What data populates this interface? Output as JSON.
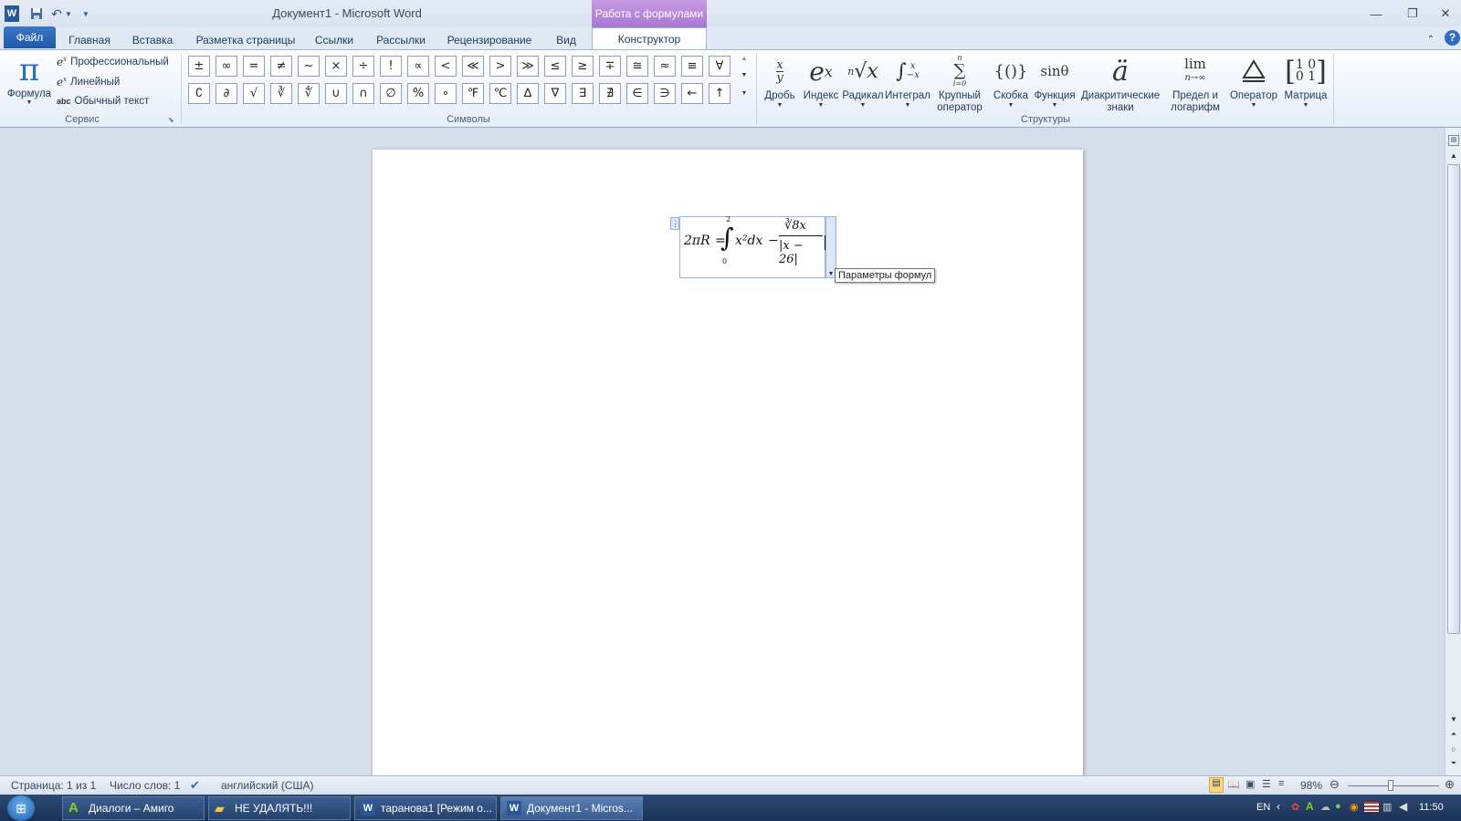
{
  "title": "Документ1  -  Microsoft Word",
  "context_tab": "Работа с формулами",
  "tabs": [
    "Файл",
    "Главная",
    "Вставка",
    "Разметка страницы",
    "Ссылки",
    "Рассылки",
    "Рецензирование",
    "Вид",
    "Конструктор"
  ],
  "service": {
    "formula_label": "Формула",
    "options": [
      "Профессиональный",
      "Линейный",
      "Обычный текст"
    ],
    "group_label": "Сервис"
  },
  "symbols": {
    "row1": [
      "±",
      "∞",
      "=",
      "≠",
      "~",
      "×",
      "÷",
      "!",
      "∝",
      "<",
      "≪",
      ">",
      "≫",
      "≤",
      "≥",
      "∓",
      "≅",
      "≈",
      "≡",
      "∀"
    ],
    "row2": [
      "∁",
      "∂",
      "√",
      "∛",
      "∜",
      "∪",
      "∩",
      "∅",
      "%",
      "∘",
      "℉",
      "℃",
      "∆",
      "∇",
      "∃",
      "∄",
      "∈",
      "∋",
      "←",
      "↑"
    ],
    "group_label": "Символы"
  },
  "structures": {
    "items": [
      {
        "label": "Дробь",
        "glyph": "x/y"
      },
      {
        "label": "Индекс",
        "glyph": "eˣ"
      },
      {
        "label": "Радикал",
        "glyph": "ⁿ√x"
      },
      {
        "label": "Интеграл",
        "glyph": "∫"
      },
      {
        "label": "Крупный оператор",
        "glyph": "∑"
      },
      {
        "label": "Скобка",
        "glyph": "{()}"
      },
      {
        "label": "Функция",
        "glyph": "sinθ"
      },
      {
        "label": "Диакритические знаки",
        "glyph": "ä"
      },
      {
        "label": "Предел и логарифм",
        "glyph": "lim"
      },
      {
        "label": "Оператор",
        "glyph": "△"
      },
      {
        "label": "Матрица",
        "glyph": "[10 01]"
      }
    ],
    "group_label": "Структуры"
  },
  "equation": {
    "lhs": "2πR",
    "eq": "=",
    "int_upper": "2",
    "int_lower": "0",
    "integrand": "x²dx",
    "minus": "−",
    "numerator": "∛8x",
    "denominator": "|x − 26|"
  },
  "tooltip": "Параметры формул",
  "status": {
    "page": "Страница: 1 из 1",
    "words": "Число слов: 1",
    "language": "английский (США)",
    "zoom": "98%"
  },
  "taskbar": {
    "items": [
      "Диалоги – Амиго",
      "НЕ УДАЛЯТЬ!!!",
      "таранова1 [Режим о...",
      "Документ1 - Micros..."
    ],
    "lang": "EN",
    "clock": "11:50"
  },
  "colors": {
    "accent": "#2b579a",
    "context": "#a777d1",
    "file_tab": "#1e5aab"
  }
}
